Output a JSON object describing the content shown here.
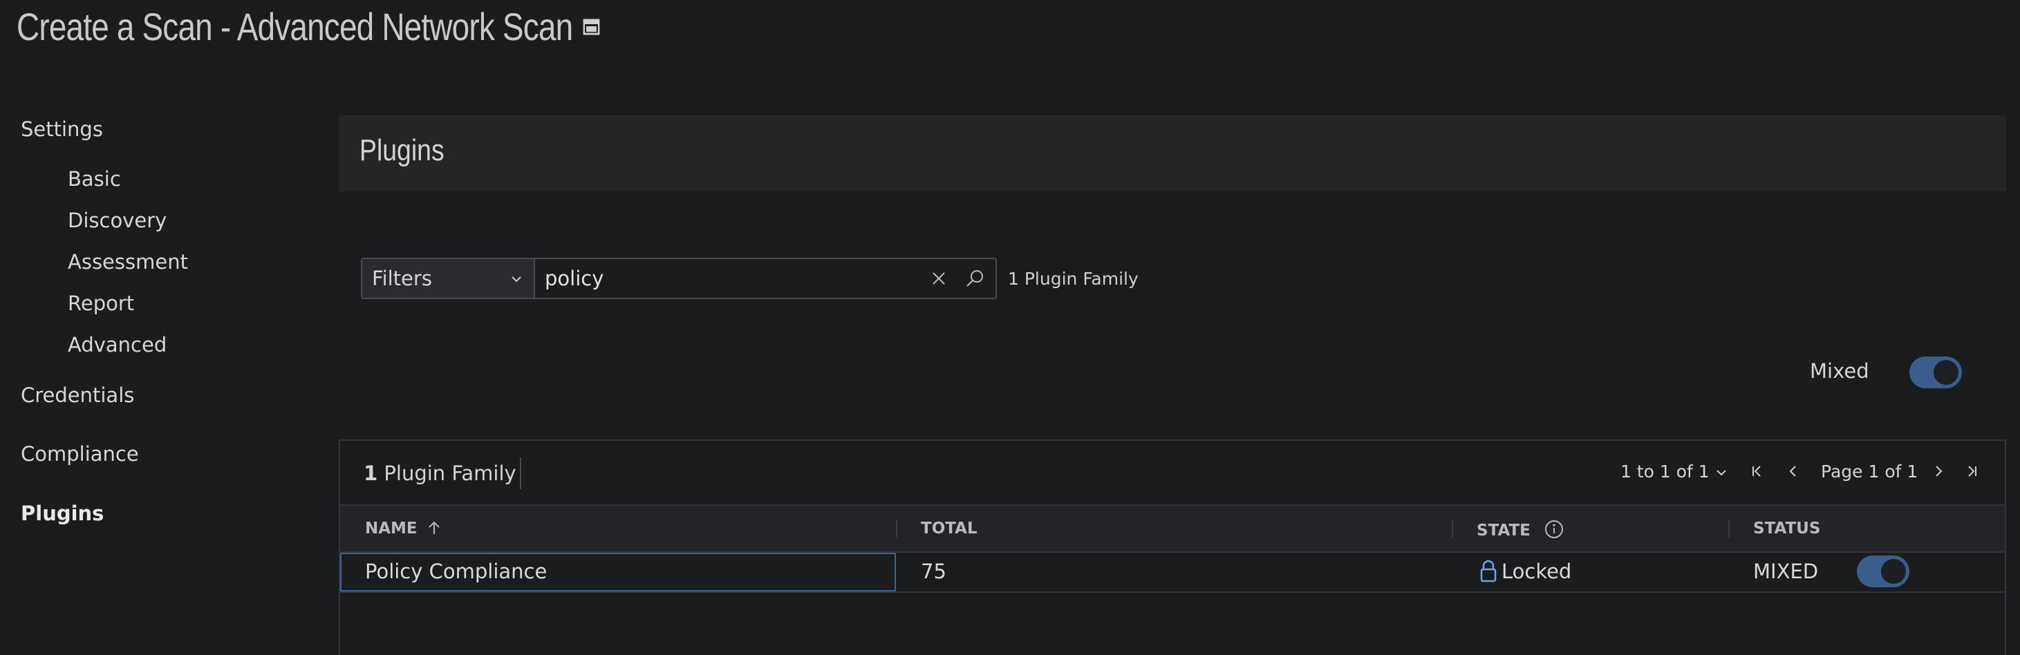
{
  "page": {
    "title": "Create a Scan - Advanced Network Scan",
    "title_icon": "external-window-icon"
  },
  "sidebar": {
    "settings": "Settings",
    "sub_items": [
      "Basic",
      "Discovery",
      "Assessment",
      "Report",
      "Advanced"
    ],
    "credentials": "Credentials",
    "compliance": "Compliance",
    "plugins": "Plugins",
    "active": "Plugins"
  },
  "plugins_panel": {
    "title": "Plugins",
    "filters_label": "Filters",
    "search_value": "policy",
    "family_count": "1 Plugin Family",
    "mixed_label": "Mixed",
    "global_toggle_state": "mixed"
  },
  "table": {
    "toolbar": {
      "count_number": "1",
      "count_label": "Plugin Family",
      "range": "1 to 1 of 1",
      "page": "Page 1 of 1"
    },
    "columns": {
      "name": "NAME",
      "total": "TOTAL",
      "state": "STATE",
      "status": "STATUS"
    },
    "rows": [
      {
        "name": "Policy Compliance",
        "total": "75",
        "state": "Locked",
        "status": "MIXED"
      }
    ]
  },
  "colors": {
    "background": "#1b1c1e",
    "accent": "#3a5d8c",
    "lock": "#6ea6e8"
  }
}
